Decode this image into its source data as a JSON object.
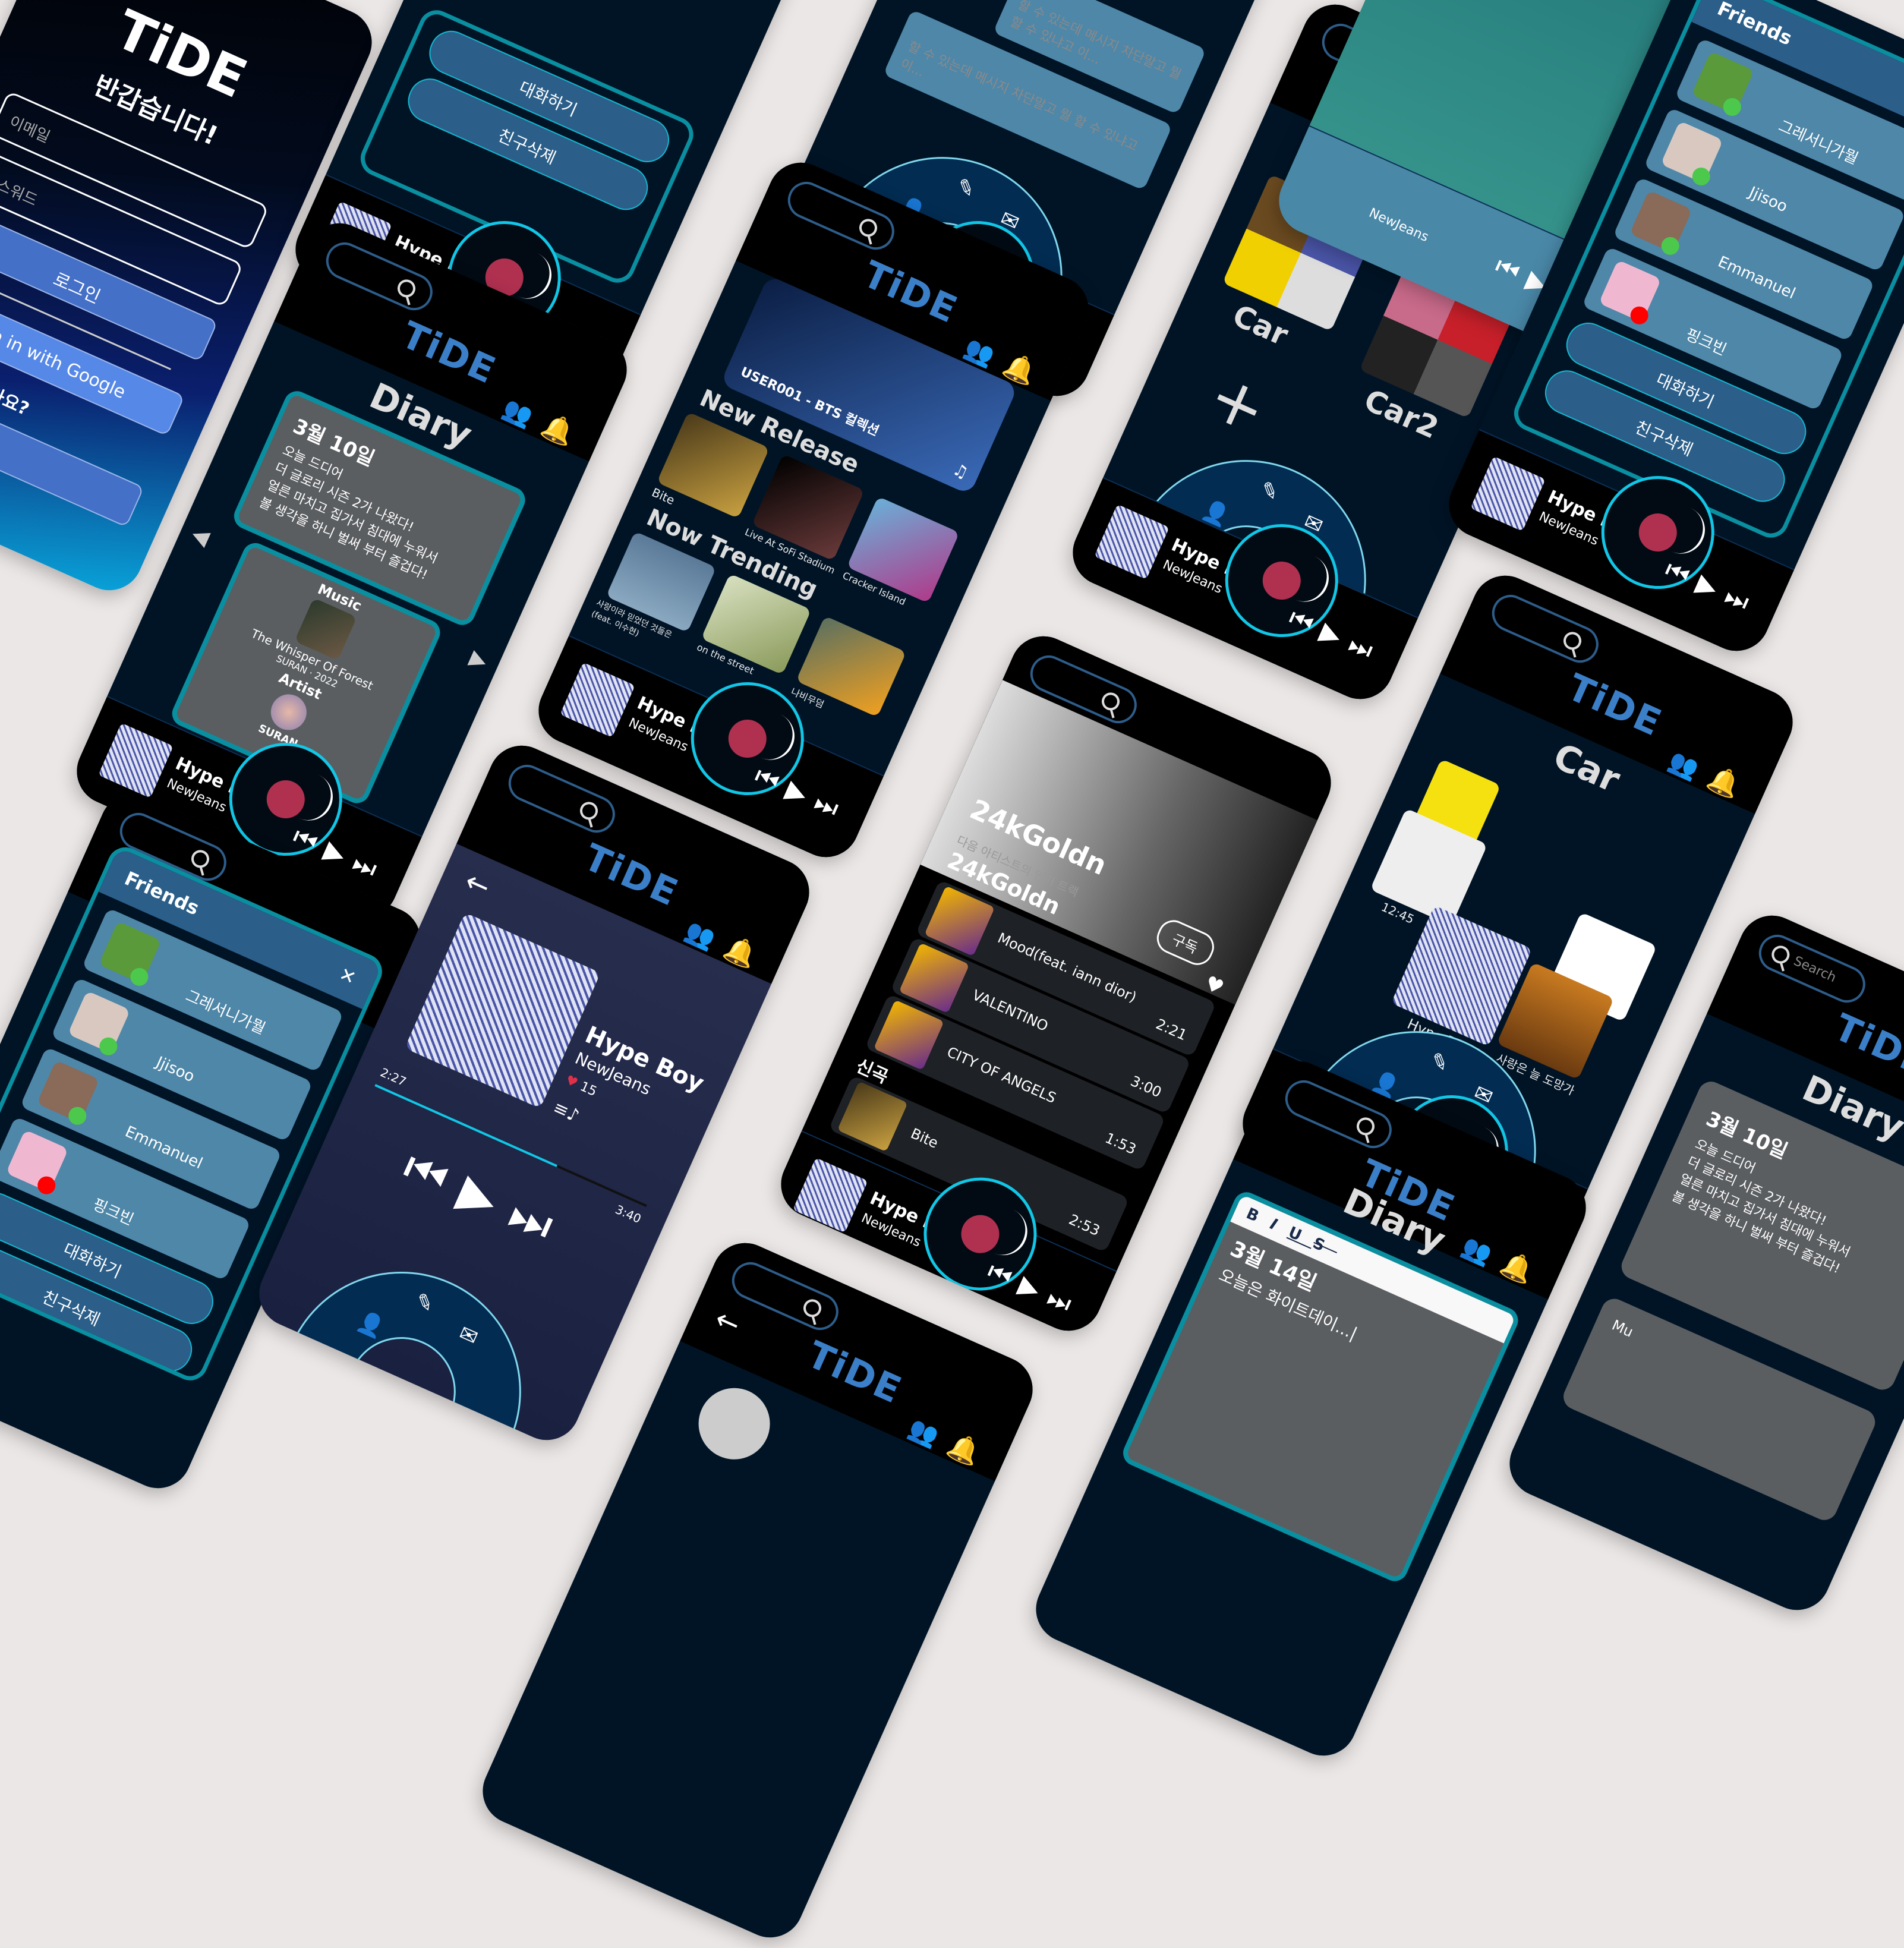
{
  "app": {
    "logo": "TiDE"
  },
  "player": {
    "title": "Hype Boy",
    "artist": "NewJeans",
    "prev": "⏮",
    "play": "▶",
    "next": "⏭"
  },
  "login": {
    "greeting": "반갑습니다!",
    "email_placeholder": "이메일",
    "password_placeholder": "패스워드",
    "login_button": "로그인",
    "google_button": "Sign in with Google",
    "no_account": "계정이 없으신가요?"
  },
  "friends": {
    "title": "Friends",
    "list": [
      {
        "name": "그레서니가뭘",
        "status": "online"
      },
      {
        "name": "Jjisoo",
        "status": "online"
      },
      {
        "name": "Emmanuel",
        "status": "online"
      },
      {
        "name": "핑크빈",
        "status": "offline"
      }
    ],
    "chat_button": "대화하기",
    "delete_button": "친구삭제",
    "status_colors": {
      "online": "#4cc94c",
      "offline": "#ff0000"
    }
  },
  "messages": {
    "preview": "할 수 있는데 메시지 차단말고 뭘 할 수 있냐고 이..."
  },
  "diary": {
    "title": "Diary",
    "date": "3월 10일",
    "lines": [
      "오늘 드디어",
      "더 글로리 시즌 2가 나왔다!",
      "얼른 마치고 집가서 침대에 누워서",
      "볼 생각을 하니 벌써 부터 즐겁다!"
    ],
    "music_label": "Music",
    "song": "The Whisper Of Forest",
    "song_artist": "SURAN",
    "song_year": "2022",
    "artist_label": "Artist",
    "artist_name": "SURAN",
    "prev_arrow": "◀",
    "next_arrow": "▶"
  },
  "editor": {
    "toolbar": [
      "B",
      "I",
      "U",
      "S"
    ],
    "date": "3월 14일",
    "text": "오늘은 화이트데이...|"
  },
  "discover": {
    "banner": "USER001 - BTS 컬렉션",
    "new_release_title": "New Release",
    "new_release": [
      "Bite",
      "Live At SoFi Stadium",
      "Cracker Island"
    ],
    "trending_title": "Now Trending",
    "trending": [
      "사랑이라 믿었던 것들은 (feat. 이수현)",
      "on the street",
      "나비무덤"
    ]
  },
  "now_playing": {
    "back": "←",
    "title": "Hype Boy",
    "artist": "NewJeans",
    "likes": "15",
    "elapsed": "2:27",
    "total": "3:40",
    "progress": 0.67
  },
  "playlists": {
    "title": "Playlists",
    "items": [
      "Car",
      "Car2"
    ],
    "add": "+"
  },
  "artist": {
    "name": "24kGoldn",
    "subscribe": "구독",
    "popular_label": "다음 아티스트의 인기 트랙",
    "tracks": [
      {
        "name": "Mood(feat. iann dior)",
        "duration": "2:21"
      },
      {
        "name": "VALENTINO",
        "duration": "3:00"
      },
      {
        "name": "CITY OF ANGELS",
        "duration": "1:53"
      }
    ],
    "new_label": "신곡",
    "new_tracks": [
      {
        "name": "Bite",
        "duration": "2:53"
      }
    ]
  },
  "car": {
    "title": "Car",
    "albums": [
      "12:45",
      "Hype Boy",
      "사랑은 늘 도망가"
    ]
  },
  "search_placeholder": "Search",
  "music_partial": "Mu",
  "colors": {
    "accent": "#3a7fc8",
    "bg": "#011426",
    "teal": "#0a8fa0",
    "bell": "#f7c600"
  }
}
